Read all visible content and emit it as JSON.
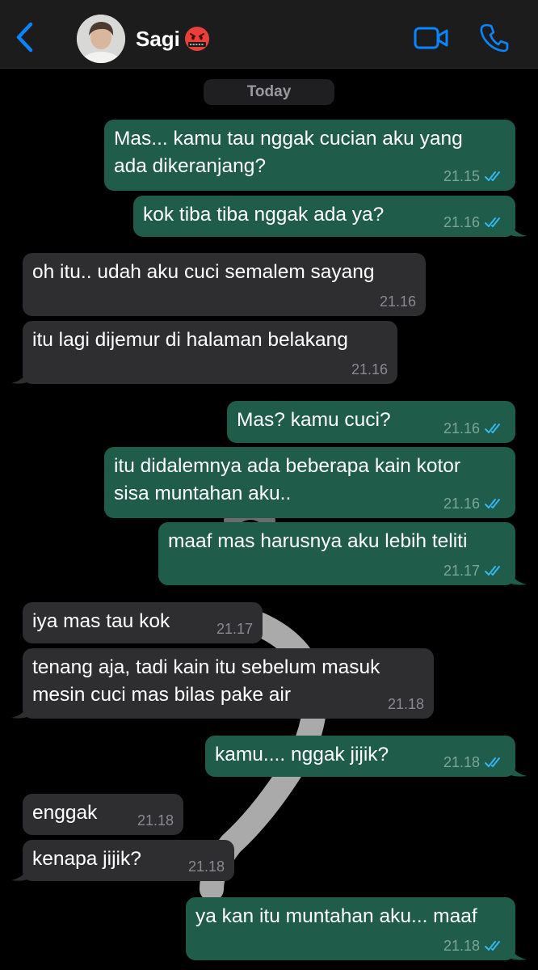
{
  "header": {
    "contact_name": "Sagi",
    "back_icon": "chevron-left-icon",
    "status_emoji": "angry-cursing-face-emoji",
    "video_icon": "video-camera-icon",
    "call_icon": "phone-icon",
    "accent_color": "#0a84ff"
  },
  "date_label": "Today",
  "colors": {
    "outgoing_bubble": "#1f5c4a",
    "incoming_bubble": "#2e2e30",
    "read_ticks": "#34b7f1"
  },
  "messages": [
    {
      "direction": "out",
      "lines": [
        "Mas... kamu tau nggak cucian aku yang",
        "ada dikeranjang?"
      ],
      "time": "21.15",
      "status": "read"
    },
    {
      "direction": "out",
      "lines": [
        "kok tiba tiba nggak ada ya?"
      ],
      "time": "21.16",
      "status": "read"
    },
    {
      "direction": "in",
      "lines": [
        "oh itu.. udah aku cuci semalem sayang"
      ],
      "time": "21.16"
    },
    {
      "direction": "in",
      "lines": [
        "itu lagi dijemur di halaman belakang"
      ],
      "time": "21.16"
    },
    {
      "direction": "out",
      "lines": [
        "Mas? kamu cuci?"
      ],
      "time": "21.16",
      "status": "read"
    },
    {
      "direction": "out",
      "lines": [
        "itu didalemnya ada beberapa kain kotor",
        "sisa muntahan aku.."
      ],
      "time": "21.16",
      "status": "read"
    },
    {
      "direction": "out",
      "lines": [
        "maaf mas harusnya aku lebih teliti"
      ],
      "time": "21.17",
      "status": "read"
    },
    {
      "direction": "in",
      "lines": [
        "iya mas tau kok"
      ],
      "time": "21.17"
    },
    {
      "direction": "in",
      "lines": [
        "tenang aja, tadi kain itu sebelum masuk",
        "mesin cuci mas bilas pake air"
      ],
      "time": "21.18"
    },
    {
      "direction": "out",
      "lines": [
        "kamu.... nggak jijik?"
      ],
      "time": "21.18",
      "status": "read"
    },
    {
      "direction": "in",
      "lines": [
        "enggak"
      ],
      "time": "21.18"
    },
    {
      "direction": "in",
      "lines": [
        "kenapa jijik?"
      ],
      "time": "21.18"
    },
    {
      "direction": "out",
      "lines": [
        "ya kan itu muntahan aku... maaf"
      ],
      "time": "21.18",
      "status": "read"
    }
  ]
}
